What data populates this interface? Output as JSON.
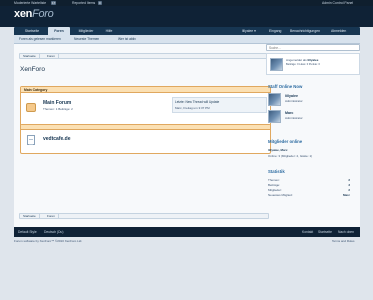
{
  "modbar": {
    "moderated": "Moderierte Warteliste",
    "moderated_count": "17",
    "reported": "Reported Items",
    "reported_count": "0",
    "admin": "Admin Control Panel"
  },
  "header": {
    "logo_main": "xen",
    "logo_sub": "Foro"
  },
  "nav": {
    "tabs": [
      {
        "label": "Startseite"
      },
      {
        "label": "Foren"
      },
      {
        "label": "Mitglieder"
      },
      {
        "label": "Hilfe"
      }
    ],
    "user": "lillyalee",
    "inbox": "Eingang",
    "notifications": "Benachrichtigungen",
    "logout": "Abmelden"
  },
  "subnav": {
    "items": [
      "Foren als gelesen markieren",
      "Neueste Themen",
      "Wer ist aktiv"
    ]
  },
  "breadcrumbs": [
    "Startseite",
    "Foren"
  ],
  "page_title": "XenForo",
  "category": {
    "title": "Main Category",
    "forum": {
      "name": "Main Forum",
      "stats_label_threads": "Themen:",
      "stats_threads": "1",
      "stats_label_posts": "Beiträge:",
      "stats_posts": "2",
      "last_title": "Letzte: New Thread will Update",
      "last_meta": "Marc, Freitag um 3:37 PM"
    }
  },
  "link_forum": {
    "name": "vedtcafe.de"
  },
  "search": {
    "placeholder": "Suche..."
  },
  "sidebar": {
    "logged_in": {
      "prefix": "Angemeldet als",
      "user": "lillyalee",
      "meta": "Beiträge: 0  Likes: 0  Punkte: 0"
    },
    "staff": {
      "title": "Staff Online Now",
      "members": [
        {
          "name": "lillyalee",
          "role": "Administrator"
        },
        {
          "name": "Marc",
          "role": "Administrator"
        }
      ]
    },
    "online": {
      "title": "Mitglieder online",
      "names": "lillyalee, Marc",
      "counts": "Online: 3 (Mitglieder: 2, Gäste: 1)"
    },
    "stats": {
      "title": "Statistik",
      "rows": [
        {
          "label": "Themen:",
          "value": "2"
        },
        {
          "label": "Beiträge:",
          "value": "3"
        },
        {
          "label": "Mitglieder:",
          "value": "2"
        },
        {
          "label": "Neuestes Mitglied:",
          "value": "Marc"
        }
      ]
    }
  },
  "footer": {
    "style": "Default Style",
    "language": "Deutsch (Du)",
    "links": [
      "Kontakt",
      "Startseite",
      "Nach oben"
    ],
    "copyright": "Forum software by XenForo™ ©2010 XenForo Ltd.",
    "terms": "Terms and Rules"
  }
}
